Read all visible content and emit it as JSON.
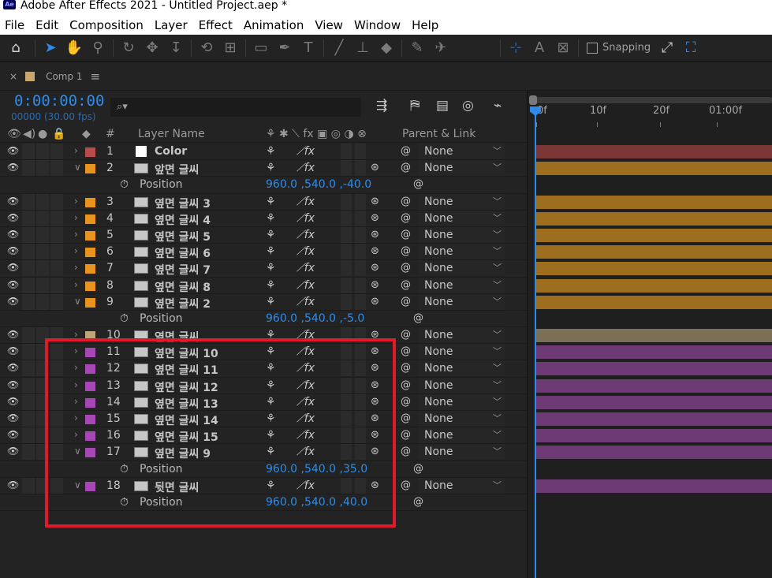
{
  "window": {
    "title": "Adobe After Effects 2021 - Untitled Project.aep *",
    "logo": "Ae"
  },
  "menu": [
    "File",
    "Edit",
    "Composition",
    "Layer",
    "Effect",
    "Animation",
    "View",
    "Window",
    "Help"
  ],
  "toolbar": {
    "tools": [
      "home-icon",
      "selection-icon",
      "hand-icon",
      "zoom-icon",
      "orbit-icon",
      "pan-icon",
      "dolly-icon",
      "rotate-icon",
      "anchor-icon",
      "rectangle-icon",
      "pen-icon",
      "type-icon",
      "brush-icon",
      "clone-stamp-icon",
      "eraser-icon",
      "roto-brush-icon",
      "puppet-pin-icon"
    ],
    "snapping_label": "Snapping"
  },
  "comp": {
    "tab_label": "Comp 1",
    "timecode": "0:00:00:00",
    "fps": "00000 (30.00 fps)",
    "search_placeholder": "⌕▾"
  },
  "columns": {
    "hash": "#",
    "layer_name": "Layer Name",
    "parent": "Parent & Link"
  },
  "ruler": [
    "0f",
    "10f",
    "20f",
    "01:00f"
  ],
  "colors": {
    "red": "#b84b4b",
    "orange": "#e8921f",
    "tan": "#bfa47a",
    "purple": "#a548b4",
    "orange_bar": "#9e6e1f",
    "purple_bar": "#6e3a76",
    "red_bar": "#7b3636",
    "tan_bar": "#7b7056",
    "accent": "#2d8ceb"
  },
  "rows": [
    {
      "type": "layer",
      "num": "1",
      "name": "Color",
      "label": "red",
      "twirl": "›",
      "icon": "solid",
      "parent": "None",
      "bar": "red_bar",
      "has3d": false
    },
    {
      "type": "layer",
      "num": "2",
      "name": "앞면 글씨",
      "label": "orange",
      "twirl": "∨",
      "icon": "image",
      "parent": "None",
      "bar": "orange_bar",
      "has3d": true
    },
    {
      "type": "prop",
      "name": "Position",
      "value": "960.0 ,540.0 ,-40.0"
    },
    {
      "type": "layer",
      "num": "3",
      "name": "옆면 글씨 3",
      "label": "orange",
      "twirl": "›",
      "icon": "image",
      "parent": "None",
      "bar": "orange_bar",
      "has3d": true
    },
    {
      "type": "layer",
      "num": "4",
      "name": "옆면 글씨 4",
      "label": "orange",
      "twirl": "›",
      "icon": "image",
      "parent": "None",
      "bar": "orange_bar",
      "has3d": true
    },
    {
      "type": "layer",
      "num": "5",
      "name": "옆면 글씨 5",
      "label": "orange",
      "twirl": "›",
      "icon": "image",
      "parent": "None",
      "bar": "orange_bar",
      "has3d": true
    },
    {
      "type": "layer",
      "num": "6",
      "name": "옆면 글씨 6",
      "label": "orange",
      "twirl": "›",
      "icon": "image",
      "parent": "None",
      "bar": "orange_bar",
      "has3d": true
    },
    {
      "type": "layer",
      "num": "7",
      "name": "옆면 글씨 7",
      "label": "orange",
      "twirl": "›",
      "icon": "image",
      "parent": "None",
      "bar": "orange_bar",
      "has3d": true
    },
    {
      "type": "layer",
      "num": "8",
      "name": "옆면 글씨 8",
      "label": "orange",
      "twirl": "›",
      "icon": "image",
      "parent": "None",
      "bar": "orange_bar",
      "has3d": true
    },
    {
      "type": "layer",
      "num": "9",
      "name": "옆면 글씨 2",
      "label": "orange",
      "twirl": "∨",
      "icon": "image",
      "parent": "None",
      "bar": "orange_bar",
      "has3d": true
    },
    {
      "type": "prop",
      "name": "Position",
      "value": "960.0 ,540.0 ,-5.0"
    },
    {
      "type": "layer",
      "num": "10",
      "name": "옆면 글씨",
      "label": "tan",
      "twirl": "›",
      "icon": "image",
      "parent": "None",
      "bar": "tan_bar",
      "has3d": true
    },
    {
      "type": "layer",
      "num": "11",
      "name": "옆면 글씨 10",
      "label": "purple",
      "twirl": "›",
      "icon": "image",
      "parent": "None",
      "bar": "purple_bar",
      "has3d": true
    },
    {
      "type": "layer",
      "num": "12",
      "name": "옆면 글씨 11",
      "label": "purple",
      "twirl": "›",
      "icon": "image",
      "parent": "None",
      "bar": "purple_bar",
      "has3d": true
    },
    {
      "type": "layer",
      "num": "13",
      "name": "옆면 글씨 12",
      "label": "purple",
      "twirl": "›",
      "icon": "image",
      "parent": "None",
      "bar": "purple_bar",
      "has3d": true
    },
    {
      "type": "layer",
      "num": "14",
      "name": "옆면 글씨 13",
      "label": "purple",
      "twirl": "›",
      "icon": "image",
      "parent": "None",
      "bar": "purple_bar",
      "has3d": true
    },
    {
      "type": "layer",
      "num": "15",
      "name": "옆면 글씨 14",
      "label": "purple",
      "twirl": "›",
      "icon": "image",
      "parent": "None",
      "bar": "purple_bar",
      "has3d": true
    },
    {
      "type": "layer",
      "num": "16",
      "name": "옆면 글씨 15",
      "label": "purple",
      "twirl": "›",
      "icon": "image",
      "parent": "None",
      "bar": "purple_bar",
      "has3d": true
    },
    {
      "type": "layer",
      "num": "17",
      "name": "옆면 글씨 9",
      "label": "purple",
      "twirl": "∨",
      "icon": "image",
      "parent": "None",
      "bar": "purple_bar",
      "has3d": true
    },
    {
      "type": "prop",
      "name": "Position",
      "value": "960.0 ,540.0 ,35.0"
    },
    {
      "type": "layer",
      "num": "18",
      "name": "뒷면 글씨",
      "label": "purple",
      "twirl": "∨",
      "icon": "image",
      "parent": "None",
      "bar": "purple_bar",
      "has3d": true
    },
    {
      "type": "prop",
      "name": "Position",
      "value": "960.0 ,540.0 ,40.0"
    }
  ]
}
